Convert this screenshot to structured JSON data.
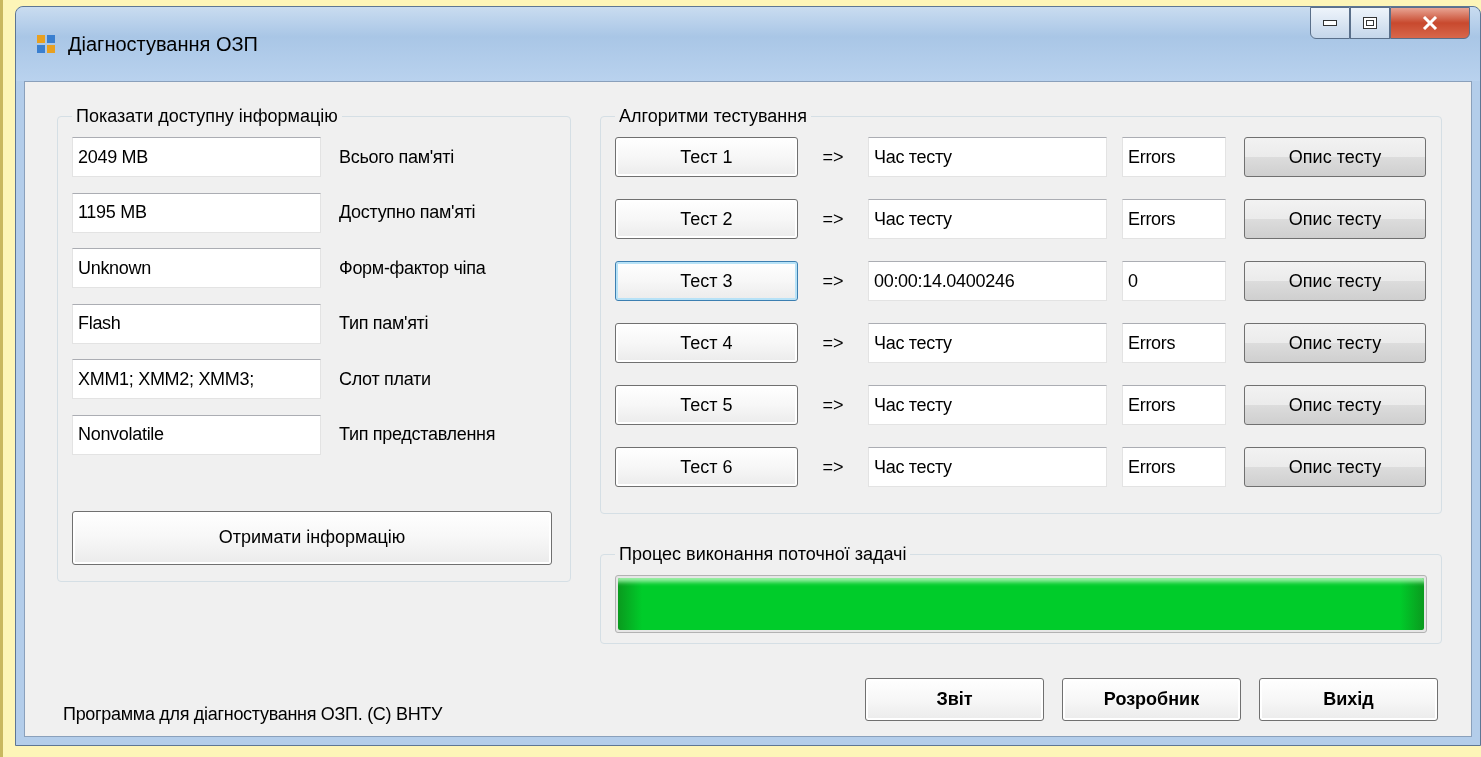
{
  "window": {
    "title": "Діагностування ОЗП"
  },
  "info": {
    "title": "Показати доступну інформацію",
    "fields": [
      {
        "value": "2049 MB",
        "label": "Всього пам'яті"
      },
      {
        "value": "1195 MB",
        "label": "Доступно пам'яті"
      },
      {
        "value": "Unknown",
        "label": "Форм-фактор чіпа"
      },
      {
        "value": "Flash",
        "label": "Тип пам'яті"
      },
      {
        "value": "XMM1; XMM2; XMM3;",
        "label": "Слот плати"
      },
      {
        "value": "Nonvolatile",
        "label": "Тип представлення"
      }
    ],
    "button": "Отримати інформацію"
  },
  "tests": {
    "title": "Алгоритми тестування",
    "rows": [
      {
        "button": "Тест 1",
        "focused": false,
        "arrow": "=>",
        "time": "Час тесту",
        "errors": "Errors",
        "describe": "Опис тесту"
      },
      {
        "button": "Тест 2",
        "focused": false,
        "arrow": "=>",
        "time": "Час тесту",
        "errors": "Errors",
        "describe": "Опис тесту"
      },
      {
        "button": "Тест 3",
        "focused": true,
        "arrow": "=>",
        "time": "00:00:14.0400246",
        "errors": "0",
        "describe": "Опис тесту"
      },
      {
        "button": "Тест 4",
        "focused": false,
        "arrow": "=>",
        "time": "Час тесту",
        "errors": "Errors",
        "describe": "Опис тесту"
      },
      {
        "button": "Тест 5",
        "focused": false,
        "arrow": "=>",
        "time": "Час тесту",
        "errors": "Errors",
        "describe": "Опис тесту"
      },
      {
        "button": "Тест 6",
        "focused": false,
        "arrow": "=>",
        "time": "Час тесту",
        "errors": "Errors",
        "describe": "Опис тесту"
      }
    ]
  },
  "progress": {
    "title": "Процес виконання поточної задачі",
    "level": 1
  },
  "footer": {
    "text": "Программа для діагностування ОЗП. (С) ВНТУ",
    "buttons": [
      "Звіт",
      "Розробник",
      "Вихід"
    ]
  }
}
